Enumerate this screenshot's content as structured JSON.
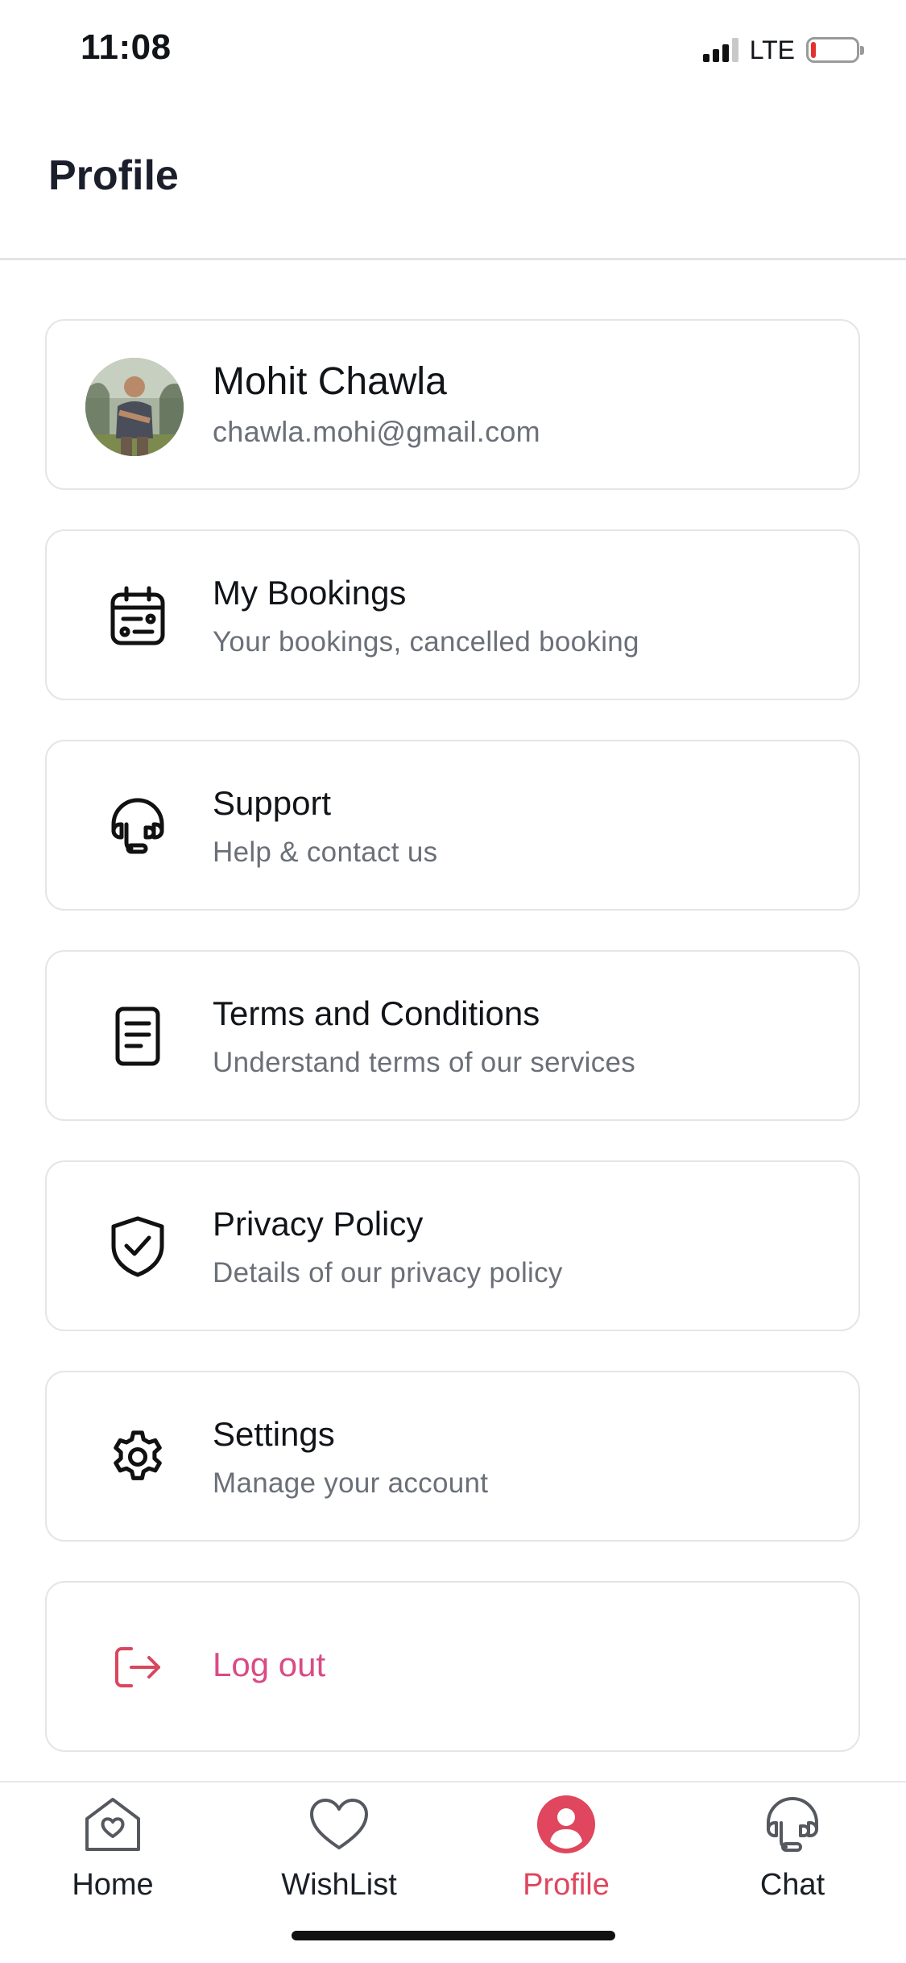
{
  "status_bar": {
    "time": "11:08",
    "network": "LTE",
    "battery_level": 0.12,
    "battery_color": "#e5312b"
  },
  "header": {
    "title": "Profile"
  },
  "profile": {
    "name": "Mohit Chawla",
    "email": "chawla.mohi@gmail.com"
  },
  "menu": [
    {
      "icon": "calendar-icon",
      "title": "My Bookings",
      "subtitle": "Your bookings, cancelled booking"
    },
    {
      "icon": "headset-icon",
      "title": "Support",
      "subtitle": "Help & contact us"
    },
    {
      "icon": "document-icon",
      "title": "Terms and Conditions",
      "subtitle": "Understand terms of our services"
    },
    {
      "icon": "shield-check-icon",
      "title": "Privacy Policy",
      "subtitle": "Details of our privacy policy"
    },
    {
      "icon": "gear-icon",
      "title": "Settings",
      "subtitle": "Manage your account"
    }
  ],
  "logout": {
    "icon": "logout-icon",
    "label": "Log out",
    "color": "#d94b86"
  },
  "bottom_nav": {
    "items": [
      {
        "icon": "home-heart-icon",
        "label": "Home",
        "active": false
      },
      {
        "icon": "heart-icon",
        "label": "WishList",
        "active": false
      },
      {
        "icon": "profile-icon",
        "label": "Profile",
        "active": true
      },
      {
        "icon": "headset-icon",
        "label": "Chat",
        "active": false
      }
    ],
    "active_color": "#e0465e"
  }
}
